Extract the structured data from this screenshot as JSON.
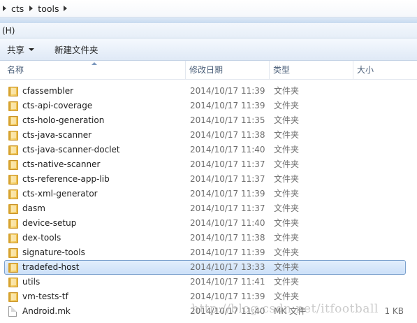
{
  "breadcrumb": [
    "cts",
    "tools"
  ],
  "menu": {
    "help_label": "(H)"
  },
  "toolbar": {
    "share_label": "共享",
    "new_folder_label": "新建文件夹"
  },
  "columns": {
    "name": "名称",
    "modified": "修改日期",
    "type": "类型",
    "size": "大小"
  },
  "files": [
    {
      "name": "cfassembler",
      "modified": "2014/10/17 11:39",
      "type": "文件夹",
      "size": "",
      "icon": "folder-icon"
    },
    {
      "name": "cts-api-coverage",
      "modified": "2014/10/17 11:39",
      "type": "文件夹",
      "size": "",
      "icon": "folder-icon"
    },
    {
      "name": "cts-holo-generation",
      "modified": "2014/10/17 11:35",
      "type": "文件夹",
      "size": "",
      "icon": "folder-icon"
    },
    {
      "name": "cts-java-scanner",
      "modified": "2014/10/17 11:38",
      "type": "文件夹",
      "size": "",
      "icon": "folder-icon"
    },
    {
      "name": "cts-java-scanner-doclet",
      "modified": "2014/10/17 11:40",
      "type": "文件夹",
      "size": "",
      "icon": "folder-icon"
    },
    {
      "name": "cts-native-scanner",
      "modified": "2014/10/17 11:37",
      "type": "文件夹",
      "size": "",
      "icon": "folder-icon"
    },
    {
      "name": "cts-reference-app-lib",
      "modified": "2014/10/17 11:37",
      "type": "文件夹",
      "size": "",
      "icon": "folder-icon"
    },
    {
      "name": "cts-xml-generator",
      "modified": "2014/10/17 11:39",
      "type": "文件夹",
      "size": "",
      "icon": "folder-icon"
    },
    {
      "name": "dasm",
      "modified": "2014/10/17 11:37",
      "type": "文件夹",
      "size": "",
      "icon": "folder-icon"
    },
    {
      "name": "device-setup",
      "modified": "2014/10/17 11:40",
      "type": "文件夹",
      "size": "",
      "icon": "folder-icon"
    },
    {
      "name": "dex-tools",
      "modified": "2014/10/17 11:38",
      "type": "文件夹",
      "size": "",
      "icon": "folder-icon"
    },
    {
      "name": "signature-tools",
      "modified": "2014/10/17 11:39",
      "type": "文件夹",
      "size": "",
      "icon": "folder-icon"
    },
    {
      "name": "tradefed-host",
      "modified": "2014/10/17 13:33",
      "type": "文件夹",
      "size": "",
      "icon": "folder-icon",
      "selected": true
    },
    {
      "name": "utils",
      "modified": "2014/10/17 11:41",
      "type": "文件夹",
      "size": "",
      "icon": "folder-icon"
    },
    {
      "name": "vm-tests-tf",
      "modified": "2014/10/17 11:39",
      "type": "文件夹",
      "size": "",
      "icon": "folder-icon"
    },
    {
      "name": "Android.mk",
      "modified": "2014/10/17 11:40",
      "type": "MK 文件",
      "size": "1 KB",
      "icon": "file-icon"
    }
  ],
  "watermark": "http://blog.csdn.net/itfootball"
}
